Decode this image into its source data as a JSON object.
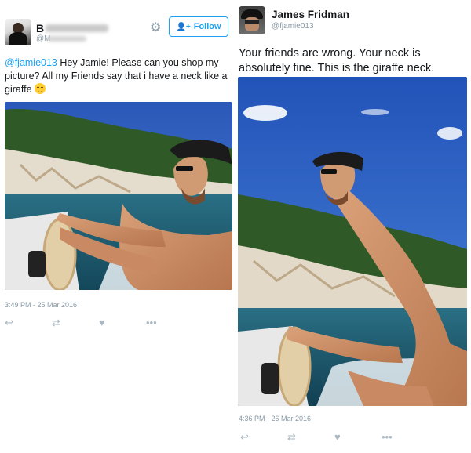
{
  "left_tweet": {
    "name_visible": "B",
    "handle_visible": "@M",
    "follow_label": "Follow",
    "mention": "@fjamie013",
    "text": " Hey Jamie! Please can you shop my picture? All my Friends say that i have a neck like a giraffe ",
    "emoji": "relieved-face-emoji",
    "timestamp": "3:49 PM - 25 Mar 2016",
    "actions": [
      "reply-icon",
      "retweet-icon",
      "like-icon",
      "more-icon"
    ]
  },
  "right_tweet": {
    "name": "James Fridman",
    "handle": "@fjamie013",
    "text": "Your friends are wrong. Your neck is absolutely fine. This is the giraffe neck.",
    "timestamp": "4:36 PM - 26 Mar 2016",
    "actions": [
      "reply-icon",
      "retweet-icon",
      "like-icon",
      "more-icon"
    ]
  },
  "colors": {
    "link_blue": "#1da1f2",
    "meta_gray": "#8899a6",
    "text_dark": "#14171a",
    "sky": "#2f5fc0",
    "sea": "#1d4f63"
  }
}
